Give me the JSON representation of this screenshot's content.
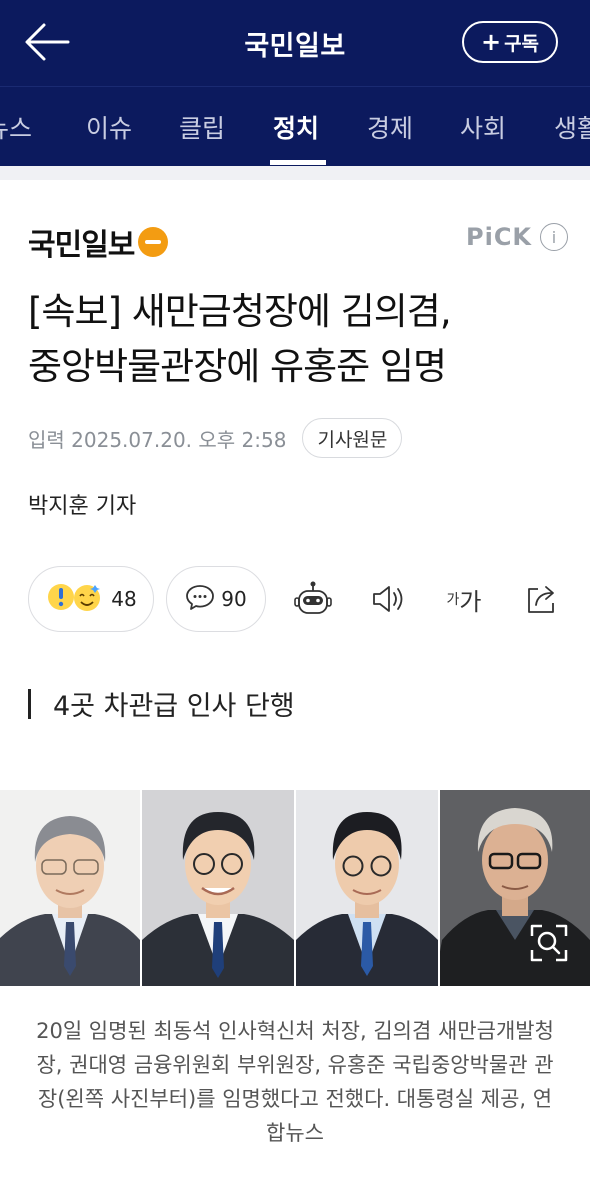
{
  "header": {
    "title": "국민일보",
    "subscribe_label": "구독",
    "back_icon": "arrow-left-icon",
    "brand_color": "#0c1a5e"
  },
  "tabs": [
    {
      "label": "뉴스",
      "active": false
    },
    {
      "label": "이슈",
      "active": false
    },
    {
      "label": "클립",
      "active": false
    },
    {
      "label": "정치",
      "active": true
    },
    {
      "label": "경제",
      "active": false
    },
    {
      "label": "사회",
      "active": false
    },
    {
      "label": "생활",
      "active": false
    }
  ],
  "press": {
    "name": "국민일보",
    "pick_label": "PiCK",
    "info_label": "i"
  },
  "article": {
    "headline_line1": "[속보] 새만금청장에 김의겸,",
    "headline_line2": "중앙박물관장에 유홍준 임명",
    "date": "입력 2025.07.20. 오후 2:58",
    "original_label": "기사원문",
    "reporter": "박지훈 기자",
    "subheading": "4곳 차관급 인사 단행",
    "caption": "20일 임명된 최동석 인사혁신처 처장, 김의겸 새만금개발청장, 권대영 금융위원회 부위원장, 유홍준 국립중앙박물관 관장(왼쪽 사진부터)를 임명했다고 전했다. 대통령실 제공, 연합뉴스"
  },
  "actions": {
    "reaction_count": "48",
    "comment_count": "90",
    "font_small": "가",
    "font_big": "가"
  }
}
